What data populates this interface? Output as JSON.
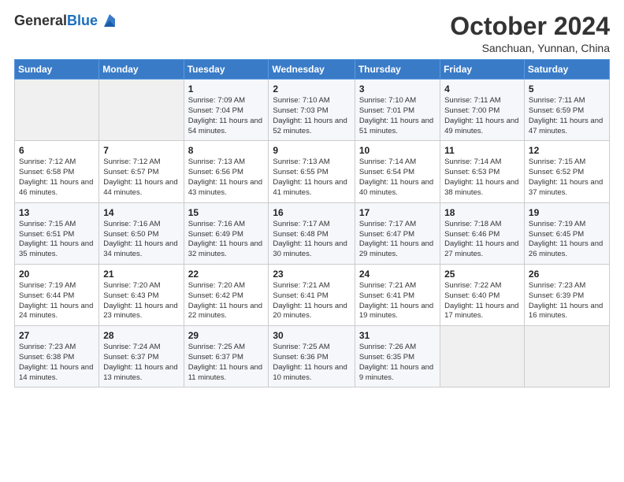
{
  "header": {
    "logo_general": "General",
    "logo_blue": "Blue",
    "month_title": "October 2024",
    "location": "Sanchuan, Yunnan, China"
  },
  "weekdays": [
    "Sunday",
    "Monday",
    "Tuesday",
    "Wednesday",
    "Thursday",
    "Friday",
    "Saturday"
  ],
  "weeks": [
    [
      {
        "day": "",
        "sunrise": "",
        "sunset": "",
        "daylight": ""
      },
      {
        "day": "",
        "sunrise": "",
        "sunset": "",
        "daylight": ""
      },
      {
        "day": "1",
        "sunrise": "Sunrise: 7:09 AM",
        "sunset": "Sunset: 7:04 PM",
        "daylight": "Daylight: 11 hours and 54 minutes."
      },
      {
        "day": "2",
        "sunrise": "Sunrise: 7:10 AM",
        "sunset": "Sunset: 7:03 PM",
        "daylight": "Daylight: 11 hours and 52 minutes."
      },
      {
        "day": "3",
        "sunrise": "Sunrise: 7:10 AM",
        "sunset": "Sunset: 7:01 PM",
        "daylight": "Daylight: 11 hours and 51 minutes."
      },
      {
        "day": "4",
        "sunrise": "Sunrise: 7:11 AM",
        "sunset": "Sunset: 7:00 PM",
        "daylight": "Daylight: 11 hours and 49 minutes."
      },
      {
        "day": "5",
        "sunrise": "Sunrise: 7:11 AM",
        "sunset": "Sunset: 6:59 PM",
        "daylight": "Daylight: 11 hours and 47 minutes."
      }
    ],
    [
      {
        "day": "6",
        "sunrise": "Sunrise: 7:12 AM",
        "sunset": "Sunset: 6:58 PM",
        "daylight": "Daylight: 11 hours and 46 minutes."
      },
      {
        "day": "7",
        "sunrise": "Sunrise: 7:12 AM",
        "sunset": "Sunset: 6:57 PM",
        "daylight": "Daylight: 11 hours and 44 minutes."
      },
      {
        "day": "8",
        "sunrise": "Sunrise: 7:13 AM",
        "sunset": "Sunset: 6:56 PM",
        "daylight": "Daylight: 11 hours and 43 minutes."
      },
      {
        "day": "9",
        "sunrise": "Sunrise: 7:13 AM",
        "sunset": "Sunset: 6:55 PM",
        "daylight": "Daylight: 11 hours and 41 minutes."
      },
      {
        "day": "10",
        "sunrise": "Sunrise: 7:14 AM",
        "sunset": "Sunset: 6:54 PM",
        "daylight": "Daylight: 11 hours and 40 minutes."
      },
      {
        "day": "11",
        "sunrise": "Sunrise: 7:14 AM",
        "sunset": "Sunset: 6:53 PM",
        "daylight": "Daylight: 11 hours and 38 minutes."
      },
      {
        "day": "12",
        "sunrise": "Sunrise: 7:15 AM",
        "sunset": "Sunset: 6:52 PM",
        "daylight": "Daylight: 11 hours and 37 minutes."
      }
    ],
    [
      {
        "day": "13",
        "sunrise": "Sunrise: 7:15 AM",
        "sunset": "Sunset: 6:51 PM",
        "daylight": "Daylight: 11 hours and 35 minutes."
      },
      {
        "day": "14",
        "sunrise": "Sunrise: 7:16 AM",
        "sunset": "Sunset: 6:50 PM",
        "daylight": "Daylight: 11 hours and 34 minutes."
      },
      {
        "day": "15",
        "sunrise": "Sunrise: 7:16 AM",
        "sunset": "Sunset: 6:49 PM",
        "daylight": "Daylight: 11 hours and 32 minutes."
      },
      {
        "day": "16",
        "sunrise": "Sunrise: 7:17 AM",
        "sunset": "Sunset: 6:48 PM",
        "daylight": "Daylight: 11 hours and 30 minutes."
      },
      {
        "day": "17",
        "sunrise": "Sunrise: 7:17 AM",
        "sunset": "Sunset: 6:47 PM",
        "daylight": "Daylight: 11 hours and 29 minutes."
      },
      {
        "day": "18",
        "sunrise": "Sunrise: 7:18 AM",
        "sunset": "Sunset: 6:46 PM",
        "daylight": "Daylight: 11 hours and 27 minutes."
      },
      {
        "day": "19",
        "sunrise": "Sunrise: 7:19 AM",
        "sunset": "Sunset: 6:45 PM",
        "daylight": "Daylight: 11 hours and 26 minutes."
      }
    ],
    [
      {
        "day": "20",
        "sunrise": "Sunrise: 7:19 AM",
        "sunset": "Sunset: 6:44 PM",
        "daylight": "Daylight: 11 hours and 24 minutes."
      },
      {
        "day": "21",
        "sunrise": "Sunrise: 7:20 AM",
        "sunset": "Sunset: 6:43 PM",
        "daylight": "Daylight: 11 hours and 23 minutes."
      },
      {
        "day": "22",
        "sunrise": "Sunrise: 7:20 AM",
        "sunset": "Sunset: 6:42 PM",
        "daylight": "Daylight: 11 hours and 22 minutes."
      },
      {
        "day": "23",
        "sunrise": "Sunrise: 7:21 AM",
        "sunset": "Sunset: 6:41 PM",
        "daylight": "Daylight: 11 hours and 20 minutes."
      },
      {
        "day": "24",
        "sunrise": "Sunrise: 7:21 AM",
        "sunset": "Sunset: 6:41 PM",
        "daylight": "Daylight: 11 hours and 19 minutes."
      },
      {
        "day": "25",
        "sunrise": "Sunrise: 7:22 AM",
        "sunset": "Sunset: 6:40 PM",
        "daylight": "Daylight: 11 hours and 17 minutes."
      },
      {
        "day": "26",
        "sunrise": "Sunrise: 7:23 AM",
        "sunset": "Sunset: 6:39 PM",
        "daylight": "Daylight: 11 hours and 16 minutes."
      }
    ],
    [
      {
        "day": "27",
        "sunrise": "Sunrise: 7:23 AM",
        "sunset": "Sunset: 6:38 PM",
        "daylight": "Daylight: 11 hours and 14 minutes."
      },
      {
        "day": "28",
        "sunrise": "Sunrise: 7:24 AM",
        "sunset": "Sunset: 6:37 PM",
        "daylight": "Daylight: 11 hours and 13 minutes."
      },
      {
        "day": "29",
        "sunrise": "Sunrise: 7:25 AM",
        "sunset": "Sunset: 6:37 PM",
        "daylight": "Daylight: 11 hours and 11 minutes."
      },
      {
        "day": "30",
        "sunrise": "Sunrise: 7:25 AM",
        "sunset": "Sunset: 6:36 PM",
        "daylight": "Daylight: 11 hours and 10 minutes."
      },
      {
        "day": "31",
        "sunrise": "Sunrise: 7:26 AM",
        "sunset": "Sunset: 6:35 PM",
        "daylight": "Daylight: 11 hours and 9 minutes."
      },
      {
        "day": "",
        "sunrise": "",
        "sunset": "",
        "daylight": ""
      },
      {
        "day": "",
        "sunrise": "",
        "sunset": "",
        "daylight": ""
      }
    ]
  ]
}
